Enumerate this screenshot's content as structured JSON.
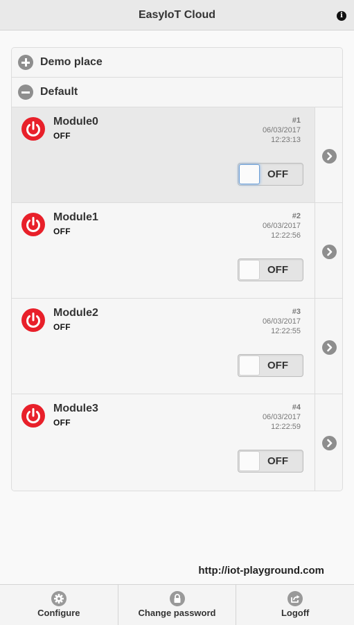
{
  "header": {
    "title": "EasyIoT Cloud",
    "info_icon": "info-icon"
  },
  "groups": [
    {
      "label": "Demo place",
      "icon": "plus-icon",
      "expanded": false
    },
    {
      "label": "Default",
      "icon": "minus-icon",
      "expanded": true
    }
  ],
  "modules": [
    {
      "name": "Module0",
      "state": "OFF",
      "number": "#1",
      "date": "06/03/2017",
      "time": "12:23:13",
      "toggle_label": "OFF",
      "toggle_on": false,
      "active": true
    },
    {
      "name": "Module1",
      "state": "OFF",
      "number": "#2",
      "date": "06/03/2017",
      "time": "12:22:56",
      "toggle_label": "OFF",
      "toggle_on": false,
      "active": false
    },
    {
      "name": "Module2",
      "state": "OFF",
      "number": "#3",
      "date": "06/03/2017",
      "time": "12:22:55",
      "toggle_label": "OFF",
      "toggle_on": false,
      "active": false
    },
    {
      "name": "Module3",
      "state": "OFF",
      "number": "#4",
      "date": "06/03/2017",
      "time": "12:22:59",
      "toggle_label": "OFF",
      "toggle_on": false,
      "active": false
    }
  ],
  "site_url": "http://iot-playground.com",
  "footer": {
    "configure_label": "Configure",
    "change_password_label": "Change password",
    "logoff_label": "Logoff"
  },
  "colors": {
    "power_off": "#e8202a",
    "header_bg": "#e9e9e9",
    "icon_gray": "#8e8e8e"
  }
}
